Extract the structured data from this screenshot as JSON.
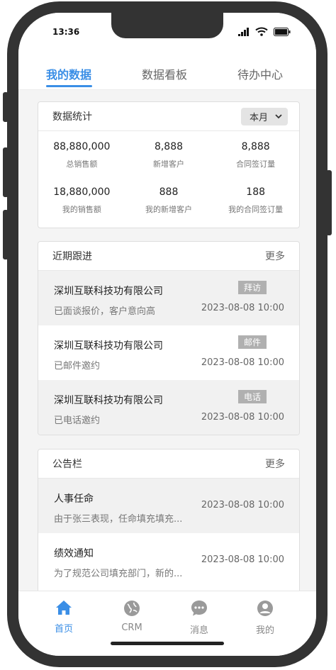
{
  "status": {
    "time": "13:36"
  },
  "tabs": [
    {
      "label": "我的数据",
      "active": true
    },
    {
      "label": "数据看板",
      "active": false
    },
    {
      "label": "待办中心",
      "active": false
    }
  ],
  "stats_card": {
    "title": "数据统计",
    "period": "本月",
    "items": [
      {
        "value": "88,880,000",
        "label": "总销售额"
      },
      {
        "value": "8,888",
        "label": "新增客户"
      },
      {
        "value": "8,888",
        "label": "合同签订量"
      },
      {
        "value": "18,880,000",
        "label": "我的销售额"
      },
      {
        "value": "888",
        "label": "我的新增客户"
      },
      {
        "value": "188",
        "label": "我的合同签订量"
      }
    ]
  },
  "followup_card": {
    "title": "近期跟进",
    "more": "更多",
    "rows": [
      {
        "company": "深圳互联科技功有限公司",
        "note": "已面谈报价，客户意向高",
        "tag": "拜访",
        "time": "2023-08-08 10:00"
      },
      {
        "company": "深圳互联科技功有限公司",
        "note": "已邮件邀约",
        "tag": "邮件",
        "time": "2023-08-08 10:00"
      },
      {
        "company": "深圳互联科技功有限公司",
        "note": "已电话邀约",
        "tag": "电话",
        "time": "2023-08-08 10:00"
      }
    ]
  },
  "notice_card": {
    "title": "公告栏",
    "more": "更多",
    "rows": [
      {
        "title": "人事任命",
        "summary": "由于张三表现，任命填充填充...",
        "time": "2023-08-08 10:00"
      },
      {
        "title": "绩效通知",
        "summary": "为了规范公司填充部门，新的...",
        "time": "2023-08-08 10:00"
      }
    ]
  },
  "bottom_nav": [
    {
      "label": "首页",
      "icon": "home-icon",
      "active": true
    },
    {
      "label": "CRM",
      "icon": "globe-icon",
      "active": false
    },
    {
      "label": "消息",
      "icon": "chat-icon",
      "active": false
    },
    {
      "label": "我的",
      "icon": "user-icon",
      "active": false
    }
  ],
  "colors": {
    "accent": "#3a8ee6",
    "frame": "#333333",
    "tag": "#b0b0b0"
  }
}
